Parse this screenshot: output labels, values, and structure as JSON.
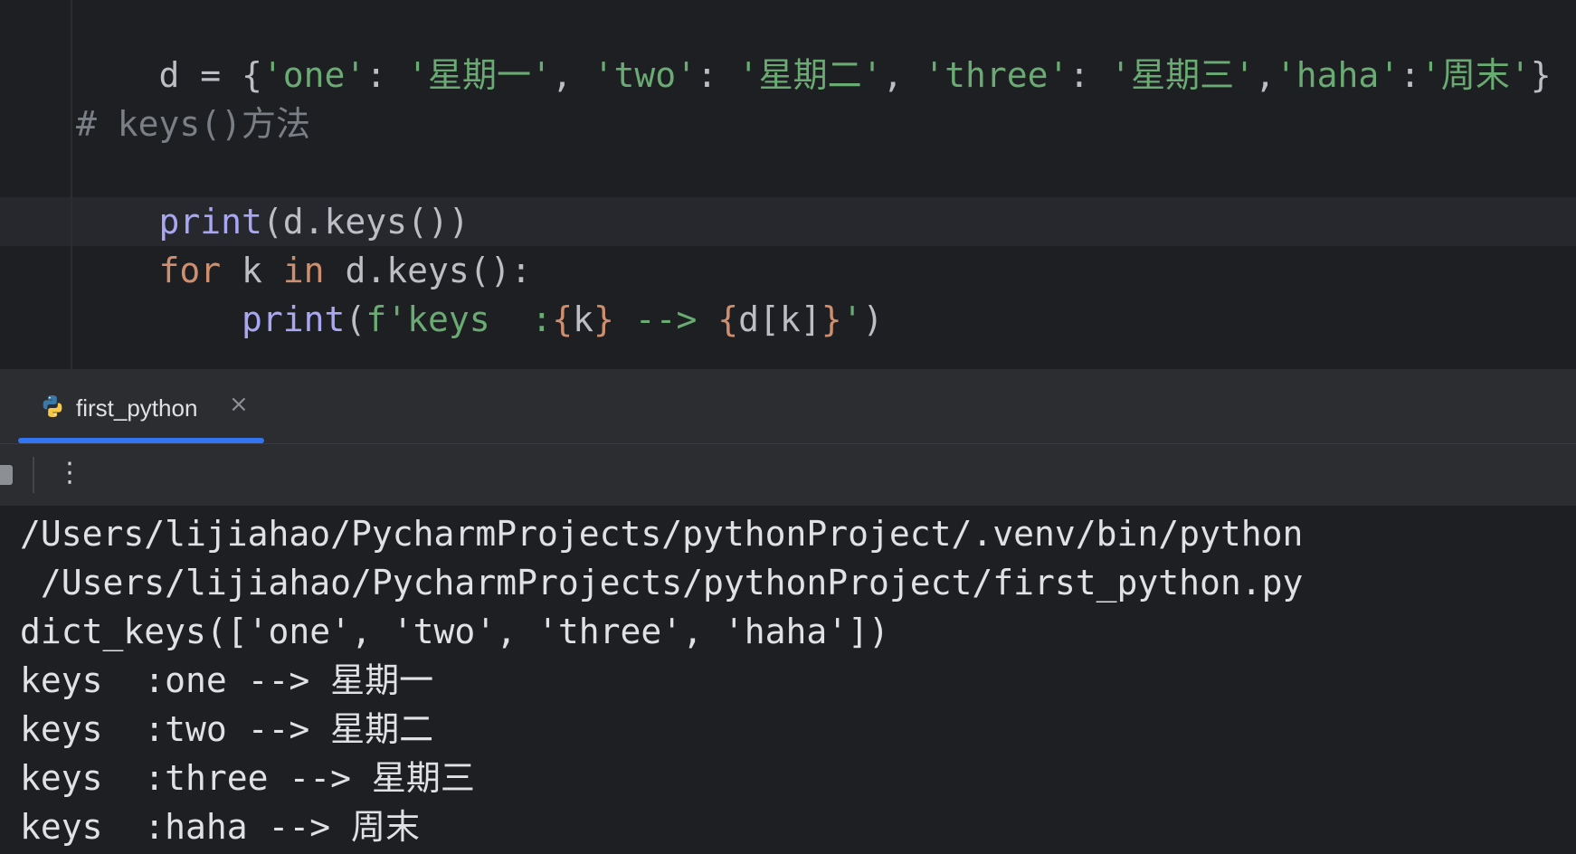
{
  "editor": {
    "line_dict": {
      "p1": "d = {",
      "s1": "'one'",
      "c1": ": ",
      "s2": "'星期一'",
      "c2": ", ",
      "s3": "'two'",
      "c3": ": ",
      "s4": "'星期二'",
      "c4": ", ",
      "s5": "'three'",
      "c5": ": ",
      "s6": "'星期三'",
      "c6": ",",
      "s7": "'haha'",
      "c7": ":",
      "s8": "'周末'",
      "p2": "}"
    },
    "line_comment": "# keys()方法",
    "line_print": {
      "fn": "print",
      "rest": "(d.keys())"
    },
    "line_for": {
      "kw1": "for",
      "mid1": " k ",
      "kw2": "in",
      "rest": " d.keys():"
    },
    "line_fprint": {
      "indent": "    ",
      "fn": "print",
      "open": "(",
      "str1": "f'keys  :",
      "b1": "{",
      "v1": "k",
      "b2": "}",
      "str2": " --> ",
      "b3": "{",
      "v2": "d[k]",
      "b4": "}",
      "str3": "'",
      "close": ")"
    }
  },
  "run_panel": {
    "tab_label": "first_python",
    "close_glyph": "×",
    "more_glyph": "⋮",
    "accent_color": "#3574f0"
  },
  "console": {
    "lines": [
      "/Users/lijiahao/PycharmProjects/pythonProject/.venv/bin/python",
      " /Users/lijiahao/PycharmProjects/pythonProject/first_python.py",
      "dict_keys(['one', 'two', 'three', 'haha'])",
      "keys  :one --> 星期一",
      "keys  :two --> 星期二",
      "keys  :three --> 星期三",
      "keys  :haha --> 周末"
    ]
  }
}
